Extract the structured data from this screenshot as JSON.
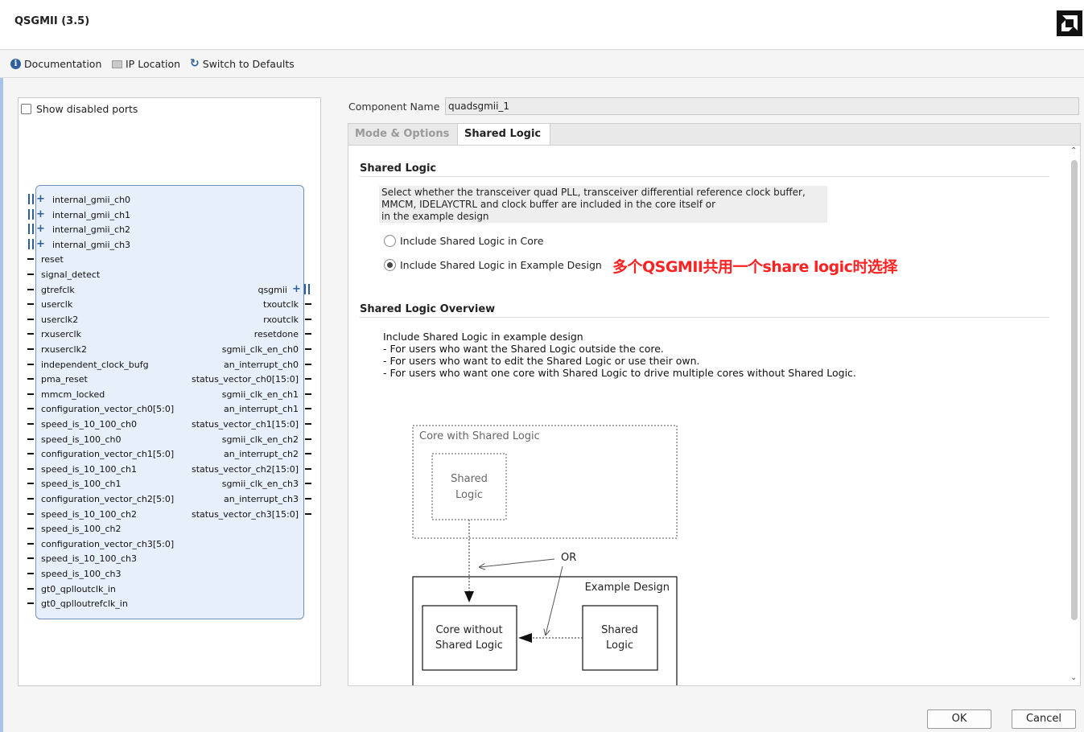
{
  "window": {
    "title": "QSGMII (3.5)",
    "logo_icon": "amd-logo-icon"
  },
  "toolbar": {
    "documentation": "Documentation",
    "ip_location": "IP Location",
    "switch_defaults": "Switch to Defaults"
  },
  "left_panel": {
    "show_disabled_ports": "Show disabled ports",
    "bus_ports": [
      "internal_gmii_ch0",
      "internal_gmii_ch1",
      "internal_gmii_ch2",
      "internal_gmii_ch3"
    ],
    "input_ports": [
      "reset",
      "signal_detect",
      "gtrefclk",
      "userclk",
      "userclk2",
      "rxuserclk",
      "rxuserclk2",
      "independent_clock_bufg",
      "pma_reset",
      "mmcm_locked",
      "configuration_vector_ch0[5:0]",
      "speed_is_10_100_ch0",
      "speed_is_100_ch0",
      "configuration_vector_ch1[5:0]",
      "speed_is_10_100_ch1",
      "speed_is_100_ch1",
      "configuration_vector_ch2[5:0]",
      "speed_is_10_100_ch2",
      "speed_is_100_ch2",
      "configuration_vector_ch3[5:0]",
      "speed_is_10_100_ch3",
      "speed_is_100_ch3",
      "gt0_qplloutclk_in",
      "gt0_qplloutrefclk_in"
    ],
    "output_bus": "qsgmii",
    "output_ports": [
      "txoutclk",
      "rxoutclk",
      "resetdone",
      "sgmii_clk_en_ch0",
      "an_interrupt_ch0",
      "status_vector_ch0[15:0]",
      "sgmii_clk_en_ch1",
      "an_interrupt_ch1",
      "status_vector_ch1[15:0]",
      "sgmii_clk_en_ch2",
      "an_interrupt_ch2",
      "status_vector_ch2[15:0]",
      "sgmii_clk_en_ch3",
      "an_interrupt_ch3",
      "status_vector_ch3[15:0]"
    ]
  },
  "component": {
    "label": "Component Name",
    "value": "quadsgmii_1"
  },
  "tabs": {
    "mode_options": "Mode & Options",
    "shared_logic": "Shared Logic"
  },
  "shared_logic": {
    "heading": "Shared Logic",
    "description": [
      "Select whether the transceiver quad PLL, transceiver differential reference clock buffer,",
      "MMCM, IDELAYCTRL and clock buffer are included in the core itself or",
      "in the example design"
    ],
    "option_core": "Include Shared Logic in Core",
    "option_example": "Include Shared Logic in Example Design",
    "selected": "example",
    "annotation": "多个QSGMII共用一个share logic时选择",
    "annotation_color": "#ff2222"
  },
  "overview": {
    "heading": "Shared Logic Overview",
    "lines": [
      "Include Shared Logic in example design",
      "- For users who want the Shared Logic outside the core.",
      "- For users who want to edit the Shared Logic or use their own.",
      "- For users who want one core with Shared Logic to drive multiple cores without Shared Logic."
    ],
    "diagram": {
      "core_with_shared": "Core with Shared Logic",
      "shared_logic_line1": "Shared",
      "shared_logic_line2": "Logic",
      "or": "OR",
      "example_design": "Example Design",
      "core_without_line1": "Core without",
      "core_without_line2": "Shared Logic"
    }
  },
  "footer": {
    "ok": "OK",
    "cancel": "Cancel"
  }
}
